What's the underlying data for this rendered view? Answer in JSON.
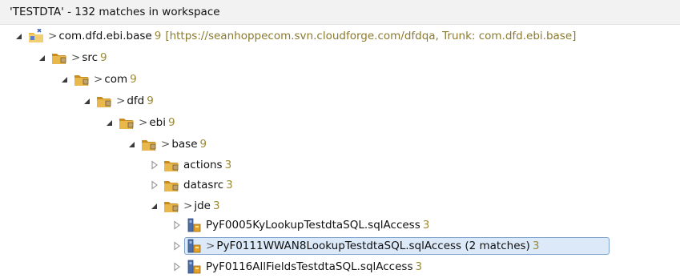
{
  "header": {
    "text": "'TESTDTA' - 132 matches in workspace"
  },
  "tree": {
    "project": {
      "arrow": ">",
      "name": "com.dfd.ebi.base",
      "count": "9",
      "repo": "[https://seanhoppecom.svn.cloudforge.com/dfdqa, Trunk: com.dfd.ebi.base]"
    },
    "src": {
      "arrow": ">",
      "name": "src",
      "count": "9"
    },
    "com": {
      "arrow": ">",
      "name": "com",
      "count": "9"
    },
    "dfd": {
      "arrow": ">",
      "name": "dfd",
      "count": "9"
    },
    "ebi": {
      "arrow": ">",
      "name": "ebi",
      "count": "9"
    },
    "base": {
      "arrow": ">",
      "name": "base",
      "count": "9"
    },
    "actions": {
      "name": "actions",
      "count": "3"
    },
    "datasrc": {
      "name": "datasrc",
      "count": "3"
    },
    "jde": {
      "arrow": ">",
      "name": "jde",
      "count": "3"
    },
    "file1": {
      "name": "PyF0005KyLookupTestdtaSQL.sqlAccess",
      "count": "3"
    },
    "file2": {
      "arrow": ">",
      "name": "PyF0111WWAN8LookupTestdtaSQL.sqlAccess (2 matches)",
      "count": "3"
    },
    "file3": {
      "name": "PyF0116AllFieldsTestdtaSQL.sqlAccess",
      "count": "3"
    }
  },
  "icons": {
    "expanded": "triangle-expanded-icon",
    "collapsed": "triangle-collapsed-icon",
    "project": "svn-project-icon",
    "package": "package-folder-icon",
    "file": "sql-access-file-icon"
  },
  "colors": {
    "count": "#9b8a34",
    "selection_bg": "#dbe9f9",
    "selection_border": "#7da2ce"
  }
}
